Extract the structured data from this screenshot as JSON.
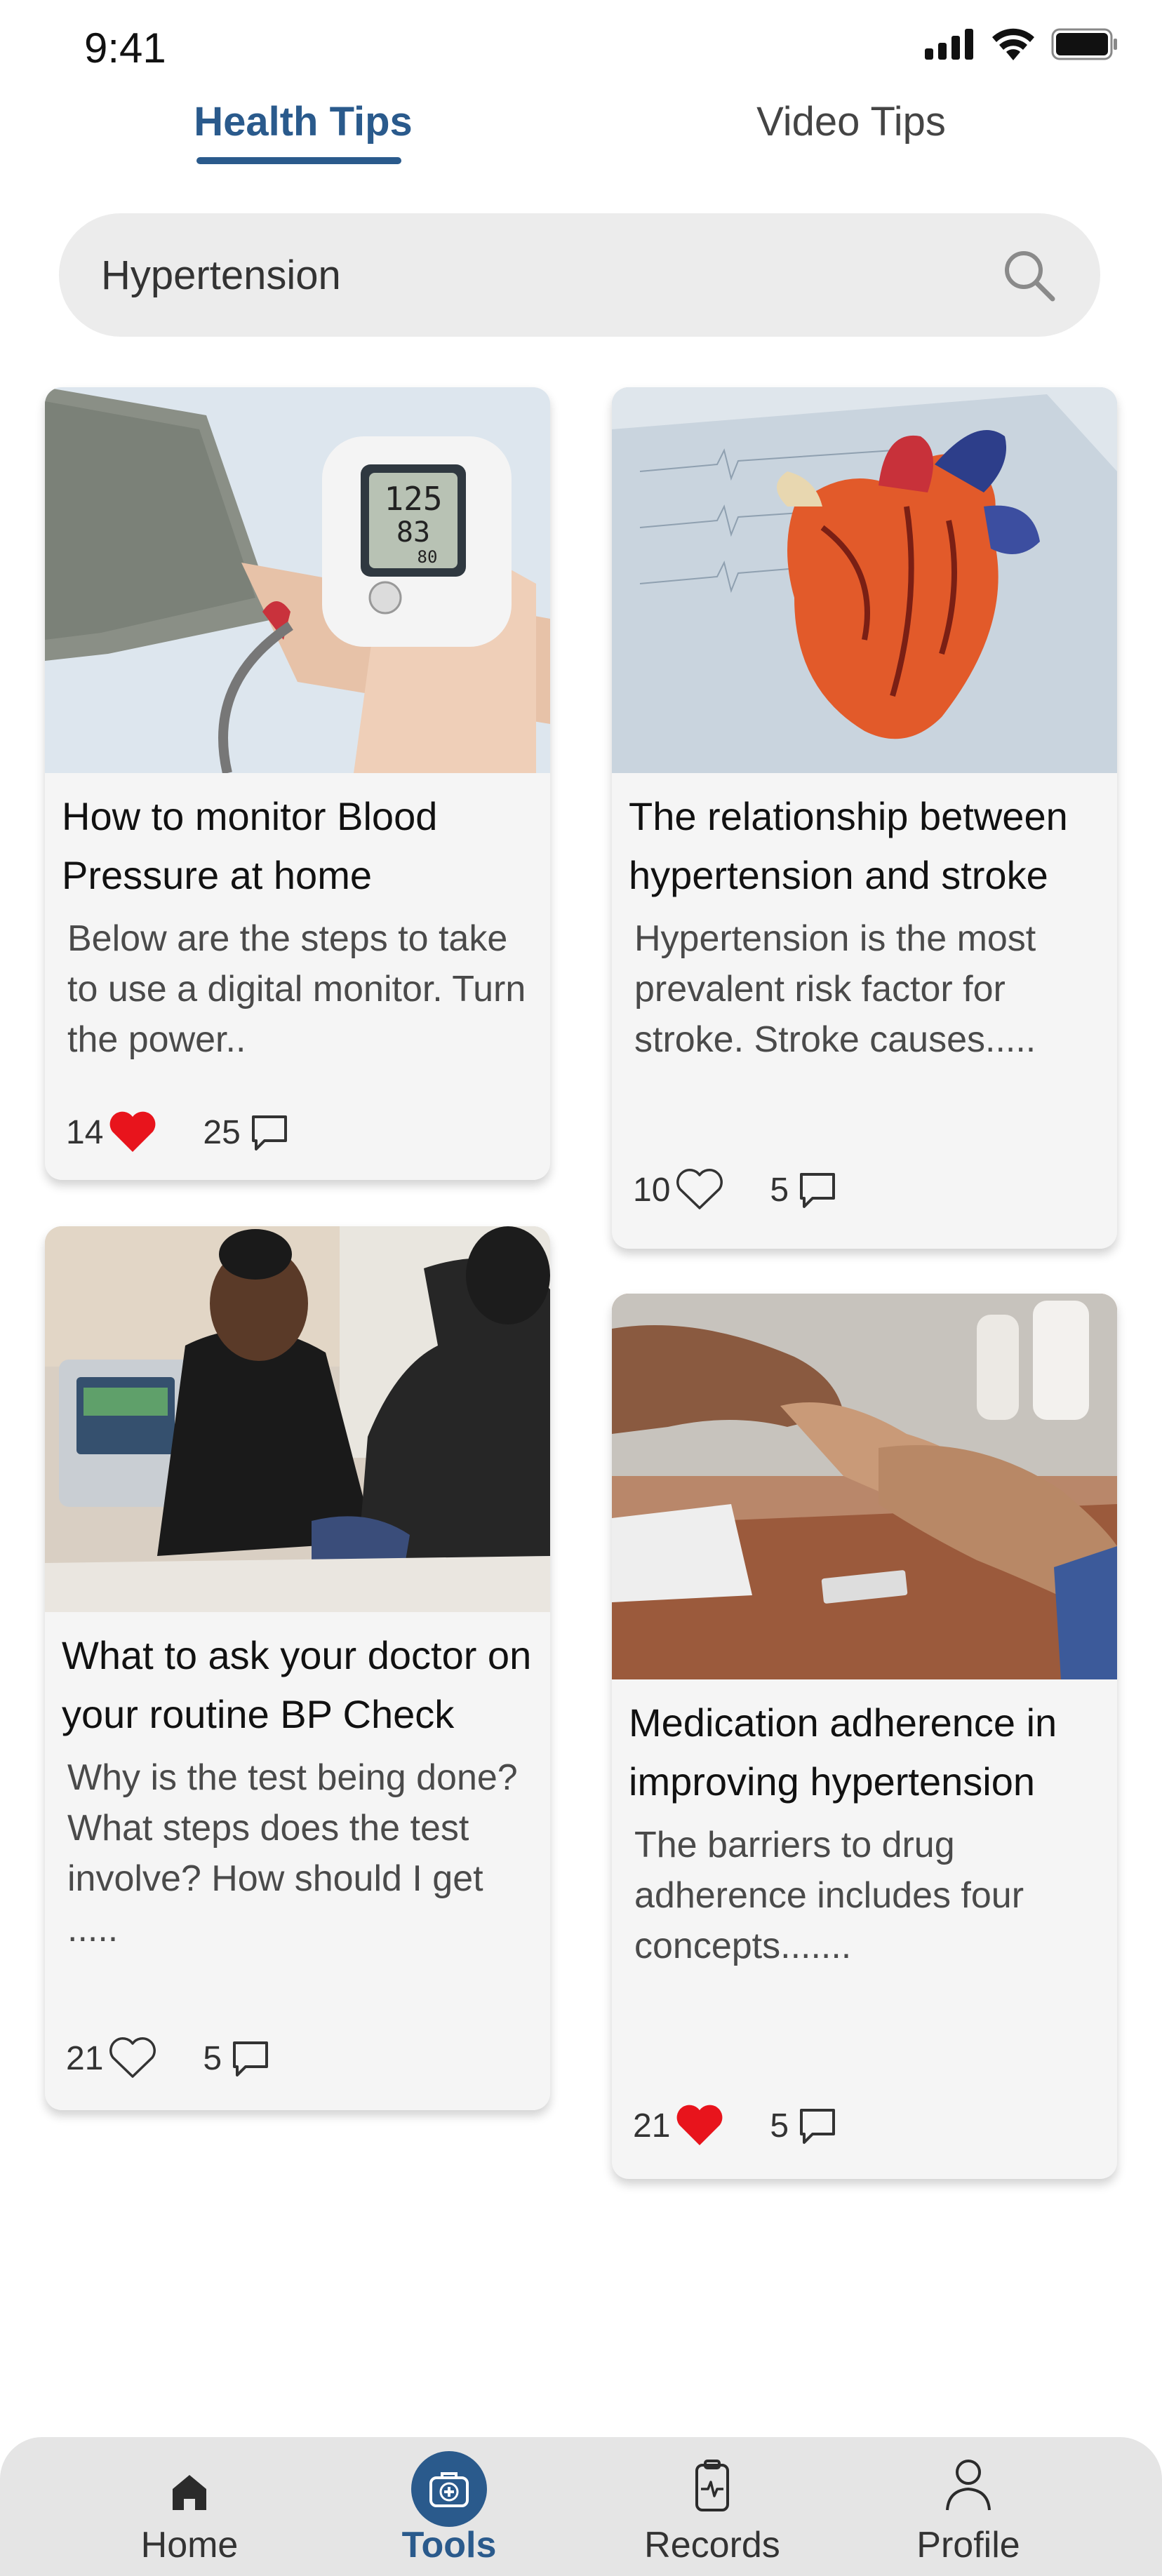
{
  "status": {
    "time": "9:41"
  },
  "tabs": {
    "health": "Health Tips",
    "video": "Video Tips"
  },
  "search": {
    "value": "Hypertension"
  },
  "cards": [
    {
      "title": "How to monitor Blood Pressure at home",
      "description": "Below are the steps to take to use a digital monitor. Turn the power..",
      "likes": "14",
      "liked": true,
      "comments": "25",
      "image": "blood-pressure-monitor-photo"
    },
    {
      "title": "The relationship between hypertension and stroke",
      "description": "Hypertension is the most prevalent risk factor for stroke. Stroke causes.....",
      "likes": "10",
      "liked": false,
      "comments": "5",
      "image": "heart-model-photo"
    },
    {
      "title": "What to ask your doctor on your routine BP Check",
      "description": "Why is the test being done? What steps does the test involve? How should I get .....",
      "likes": "21",
      "liked": false,
      "comments": "5",
      "image": "nurse-bp-check-photo"
    },
    {
      "title": "Medication adherence in improving hypertension",
      "description": "The barriers to drug adherence includes four concepts.......",
      "likes": "21",
      "liked": true,
      "comments": "5",
      "image": "medication-hands-photo"
    }
  ],
  "nav": {
    "home": "Home",
    "tools": "Tools",
    "records": "Records",
    "profile": "Profile",
    "active": "tools"
  },
  "colors": {
    "accent": "#2a5a8c",
    "like": "#e8141c",
    "card_bg": "#f5f5f5",
    "nav_bg": "#e5e5e5"
  }
}
